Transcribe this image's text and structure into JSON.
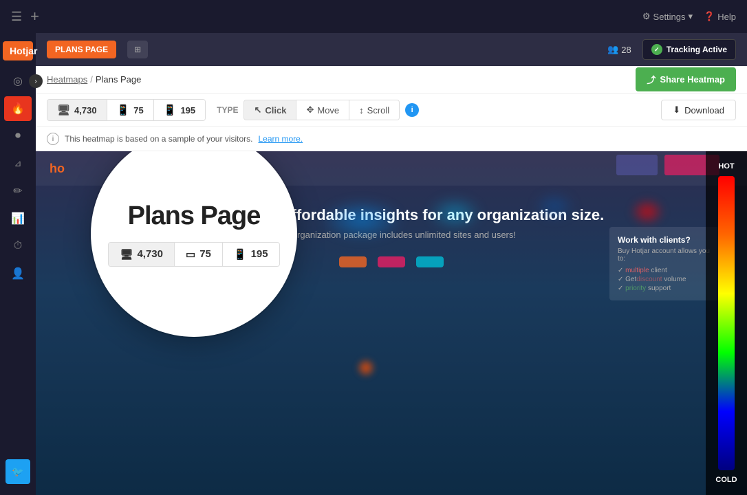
{
  "topNav": {
    "sidebar_toggle": "☰",
    "add_btn": "+",
    "settings_label": "Settings",
    "help_label": "Help"
  },
  "secondaryNav": {
    "site_name": "PLANS PAGE",
    "pages_btn": "⊞",
    "user_count": "28",
    "tracking_label": "Tracking Active"
  },
  "breadcrumb": {
    "parent": "Heatmaps",
    "separator": "/",
    "current": "Plans Page"
  },
  "actions": {
    "share_btn_icon": "⤴",
    "share_btn_label": "Share Heatmap"
  },
  "toolbar": {
    "desktop_count": "4,730",
    "tablet_count": "75",
    "mobile_count": "195",
    "type_label": "TYPE",
    "click_label": "Click",
    "move_label": "Move",
    "scroll_label": "Scroll",
    "info_label": "i",
    "download_icon": "⬇",
    "download_label": "Download"
  },
  "infoBanner": {
    "icon": "i",
    "text": "This heatmap is based on a sample of your visitors.",
    "learn_more": "Learn more."
  },
  "heatmap": {
    "nav_logo": "ho",
    "headline": "Complete and affordable insights for any organization size.",
    "subheadline": "Every organization package includes unlimited sites and users!",
    "hot_label": "HOT",
    "cold_label": "COLD",
    "clients_heading": "Work with clients?",
    "clients_text": "Buy Hotjar account allows you to:"
  },
  "magnifier": {
    "title": "Plans Page",
    "desktop_count": "4,730",
    "tablet_count": "75",
    "mobile_count": "195"
  },
  "sidebar": {
    "logo": "Hotjar",
    "icons": [
      {
        "id": "dashboard",
        "symbol": "◎"
      },
      {
        "id": "heatmaps",
        "symbol": "🔥"
      },
      {
        "id": "recordings",
        "symbol": "⏺"
      },
      {
        "id": "funnels",
        "symbol": "⟥"
      },
      {
        "id": "surveys",
        "symbol": "✏"
      },
      {
        "id": "analytics",
        "symbol": "📊"
      },
      {
        "id": "history",
        "symbol": "⏱"
      },
      {
        "id": "users",
        "symbol": "👤"
      }
    ],
    "twitter_icon": "🐦"
  },
  "colors": {
    "orange": "#f26522",
    "green": "#4caf50",
    "blue": "#2196f3",
    "dark_bg": "#1a1a2e",
    "nav_bg": "#2d2d44",
    "active_sidebar": "#e8351e"
  }
}
